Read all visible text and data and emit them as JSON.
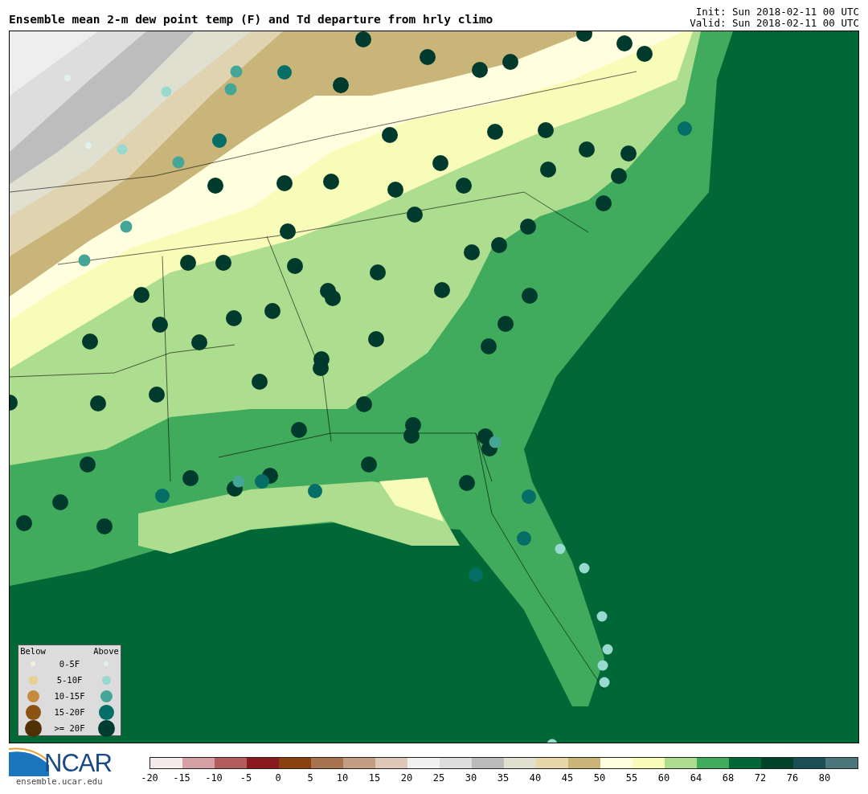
{
  "title": "Ensemble mean 2-m dew point temp (F) and Td departure from hrly climo",
  "init": "Init: Sun 2018-02-11 00 UTC",
  "valid": "Valid: Sun 2018-02-11 00 UTC",
  "legend": {
    "below_label": "Below",
    "above_label": "Above",
    "rows": [
      {
        "label": "0-5F",
        "below": {
          "color": "#f5f0d8"
        },
        "above": {
          "color": "#e0eff0"
        }
      },
      {
        "label": "5-10F",
        "below": {
          "color": "#e8d08e"
        },
        "above": {
          "color": "#98d9d0"
        }
      },
      {
        "label": "10-15F",
        "below": {
          "color": "#c68a3c"
        },
        "above": {
          "color": "#45a597"
        }
      },
      {
        "label": "15-20F",
        "below": {
          "color": "#8c5212"
        },
        "above": {
          "color": "#046e67"
        }
      },
      {
        "label": ">= 20F",
        "below": {
          "color": "#523005"
        },
        "above": {
          "color": "#003c30"
        }
      }
    ]
  },
  "logo": {
    "text": "NCAR",
    "url": "ensemble.ucar.edu"
  },
  "colorbar": {
    "swatches": [
      {
        "color": "#f5eaea"
      },
      {
        "color": "#d4a0a4"
      },
      {
        "color": "#b25c5e"
      },
      {
        "color": "#8b1a1e"
      },
      {
        "color": "#8b4010"
      },
      {
        "color": "#a87450"
      },
      {
        "color": "#c49e82"
      },
      {
        "color": "#e0c8b8"
      },
      {
        "color": "#f0f0f0"
      },
      {
        "color": "#dddddd"
      },
      {
        "color": "#bababa"
      },
      {
        "color": "#e0e0d0"
      },
      {
        "color": "#e6d6a8"
      },
      {
        "color": "#cbb477"
      },
      {
        "color": "#ffffe0"
      },
      {
        "color": "#f7fcb9"
      },
      {
        "color": "#addd8e"
      },
      {
        "color": "#41ab5d"
      },
      {
        "color": "#006837"
      },
      {
        "color": "#00432a"
      },
      {
        "color": "#1a4f55"
      },
      {
        "color": "#4b777a"
      }
    ],
    "ticks": [
      "-20",
      "-15",
      "-10",
      "-5",
      "0",
      "5",
      "10",
      "15",
      "20",
      "25",
      "30",
      "35",
      "40",
      "45",
      "50",
      "55",
      "60",
      "64",
      "68",
      "72",
      "76",
      "80"
    ]
  }
}
